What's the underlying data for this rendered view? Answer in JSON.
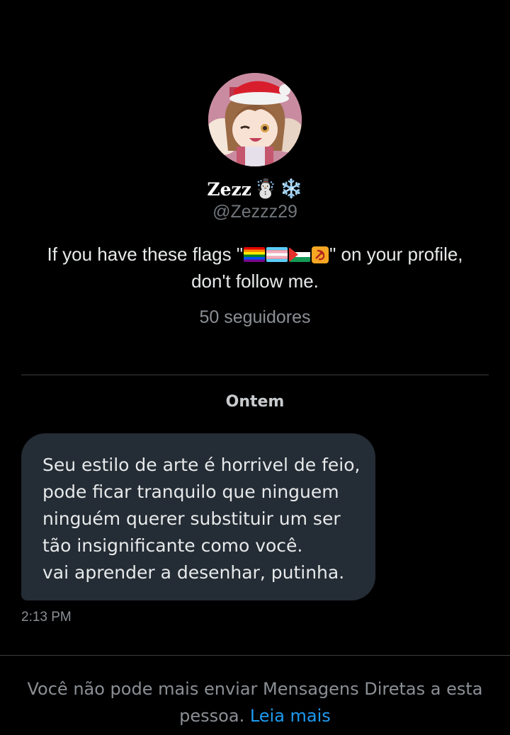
{
  "profile": {
    "display_name": "Zezz",
    "name_emojis": [
      "☃️",
      "❄️"
    ],
    "handle": "@Zezzz29",
    "bio_before": "If you have these flags \"",
    "bio_after": "\" on your profile, don't follow me.",
    "bio_flags": [
      "rainbow-flag-icon",
      "transgender-flag-icon",
      "palestine-flag-icon",
      "hammer-sickle-icon"
    ],
    "followers": "50 seguidores"
  },
  "conversation": {
    "date_label": "Ontem",
    "message": {
      "text": "Seu estilo de arte é horrivel de feio,\npode ficar tranquilo que ninguem\nninguém querer substituir um ser\ntão insignificante como você.\nvai aprender a desenhar, putinha.",
      "time": "2:13 PM"
    }
  },
  "footer": {
    "notice_text": "Você não pode mais enviar Mensagens Diretas a esta pessoa. ",
    "link_label": "Leia mais"
  },
  "colors": {
    "background": "#000000",
    "bubble": "#242c35",
    "muted_text": "#71767b",
    "link": "#1d9bf0"
  }
}
